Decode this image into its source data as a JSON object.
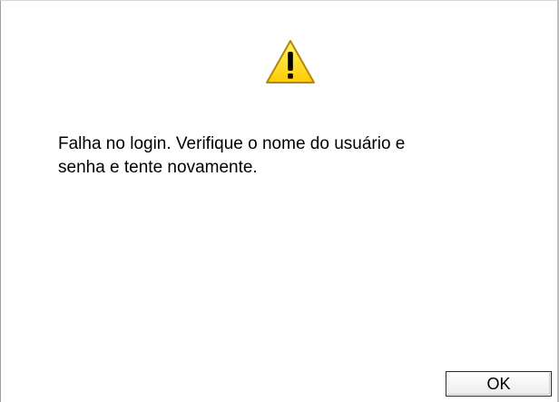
{
  "dialog": {
    "icon": "warning-icon",
    "message": "Falha no login. Verifique o nome do usuário e\nsenha e tente novamente.",
    "ok_label": "OK"
  },
  "colors": {
    "warning_fill": "#ffd800",
    "warning_stroke": "#b8860b"
  }
}
